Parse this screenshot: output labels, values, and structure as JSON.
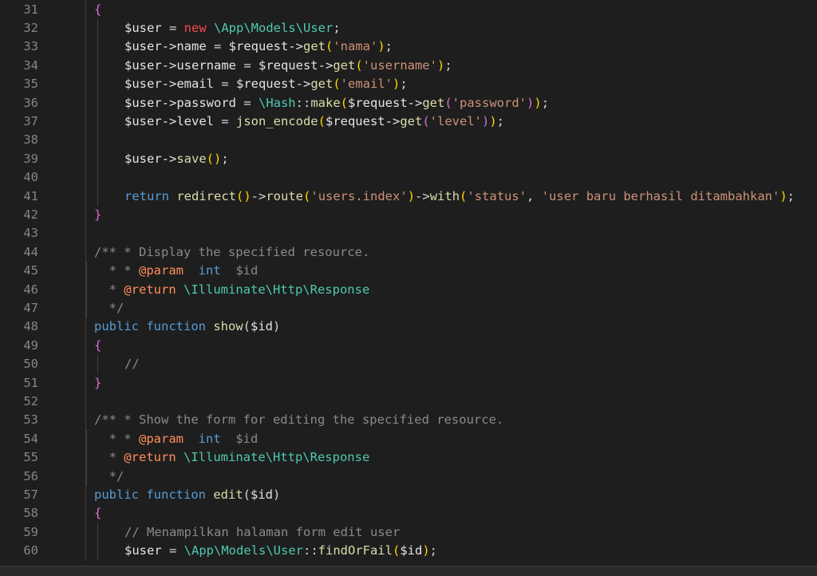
{
  "editor": {
    "colors": {
      "background": "#1e1e1e",
      "line_number": "#858585",
      "keyword": "#569cd6",
      "string": "#ce9178",
      "class": "#4ec9b0",
      "function": "#dcdcaa",
      "comment": "#8a8a8a",
      "new_keyword": "#f44747"
    },
    "lines": [
      {
        "n": "31",
        "indent": 1,
        "tokens": [
          [
            "{",
            "b"
          ]
        ]
      },
      {
        "n": "32",
        "indent": 2,
        "tokens": [
          [
            "$user",
            "v"
          ],
          [
            " = ",
            "t"
          ],
          [
            "new",
            "n"
          ],
          [
            " ",
            "t"
          ],
          [
            "\\App\\Models\\User",
            "c"
          ],
          [
            ";",
            "t"
          ]
        ]
      },
      {
        "n": "33",
        "indent": 2,
        "tokens": [
          [
            "$user->name",
            "v"
          ],
          [
            " = ",
            "t"
          ],
          [
            "$request->",
            "v"
          ],
          [
            "get",
            "f"
          ],
          [
            "(",
            "y"
          ],
          [
            "'nama'",
            "s"
          ],
          [
            ")",
            "y"
          ],
          [
            ";",
            "t"
          ]
        ]
      },
      {
        "n": "34",
        "indent": 2,
        "tokens": [
          [
            "$user->username",
            "v"
          ],
          [
            " = ",
            "t"
          ],
          [
            "$request->",
            "v"
          ],
          [
            "get",
            "f"
          ],
          [
            "(",
            "y"
          ],
          [
            "'username'",
            "s"
          ],
          [
            ")",
            "y"
          ],
          [
            ";",
            "t"
          ]
        ]
      },
      {
        "n": "35",
        "indent": 2,
        "tokens": [
          [
            "$user->email",
            "v"
          ],
          [
            " = ",
            "t"
          ],
          [
            "$request->",
            "v"
          ],
          [
            "get",
            "f"
          ],
          [
            "(",
            "y"
          ],
          [
            "'email'",
            "s"
          ],
          [
            ")",
            "y"
          ],
          [
            ";",
            "t"
          ]
        ]
      },
      {
        "n": "36",
        "indent": 2,
        "tokens": [
          [
            "$user->password",
            "v"
          ],
          [
            " = ",
            "t"
          ],
          [
            "\\Hash",
            "c"
          ],
          [
            "::",
            "t"
          ],
          [
            "make",
            "f"
          ],
          [
            "(",
            "y"
          ],
          [
            "$request->",
            "v"
          ],
          [
            "get",
            "f"
          ],
          [
            "(",
            "b"
          ],
          [
            "'password'",
            "s"
          ],
          [
            ")",
            "b"
          ],
          [
            ")",
            "y"
          ],
          [
            ";",
            "t"
          ]
        ]
      },
      {
        "n": "37",
        "indent": 2,
        "tokens": [
          [
            "$user->level",
            "v"
          ],
          [
            " = ",
            "t"
          ],
          [
            "json_encode",
            "f"
          ],
          [
            "(",
            "y"
          ],
          [
            "$request->",
            "v"
          ],
          [
            "get",
            "f"
          ],
          [
            "(",
            "b"
          ],
          [
            "'level'",
            "s"
          ],
          [
            ")",
            "b"
          ],
          [
            ")",
            "y"
          ],
          [
            ";",
            "t"
          ]
        ]
      },
      {
        "n": "38",
        "indent": 2,
        "tokens": []
      },
      {
        "n": "39",
        "indent": 2,
        "tokens": [
          [
            "$user->",
            "v"
          ],
          [
            "save",
            "f"
          ],
          [
            "()",
            "y"
          ],
          [
            ";",
            "t"
          ]
        ]
      },
      {
        "n": "40",
        "indent": 2,
        "tokens": []
      },
      {
        "n": "41",
        "indent": 2,
        "tokens": [
          [
            "return",
            "k"
          ],
          [
            " ",
            "t"
          ],
          [
            "redirect",
            "f"
          ],
          [
            "()",
            "y"
          ],
          [
            "->",
            "t"
          ],
          [
            "route",
            "f"
          ],
          [
            "(",
            "y"
          ],
          [
            "'users.index'",
            "s"
          ],
          [
            ")",
            "y"
          ],
          [
            "->",
            "t"
          ],
          [
            "with",
            "f"
          ],
          [
            "(",
            "y"
          ],
          [
            "'status'",
            "s"
          ],
          [
            ", ",
            "t"
          ],
          [
            "'user baru berhasil ditambahkan'",
            "s"
          ],
          [
            ")",
            "y"
          ],
          [
            ";",
            "t"
          ]
        ]
      },
      {
        "n": "42",
        "indent": 1,
        "tokens": [
          [
            "}",
            "b"
          ]
        ]
      },
      {
        "n": "43",
        "indent": 1,
        "tokens": []
      },
      {
        "n": "44",
        "indent": 1,
        "tokens": [
          [
            "/** * Display the specified resource.",
            "g"
          ]
        ]
      },
      {
        "n": "45",
        "indent": 1,
        "tokens": [
          [
            "  * * ",
            "g"
          ],
          [
            "@param",
            "d"
          ],
          [
            "  ",
            "t"
          ],
          [
            "int",
            "k"
          ],
          [
            "  $id",
            "g"
          ]
        ]
      },
      {
        "n": "46",
        "indent": 1,
        "tokens": [
          [
            "  * ",
            "g"
          ],
          [
            "@return",
            "d"
          ],
          [
            " ",
            "t"
          ],
          [
            "\\Illuminate\\Http\\Response",
            "c"
          ]
        ]
      },
      {
        "n": "47",
        "indent": 1,
        "tokens": [
          [
            "  */",
            "g"
          ]
        ]
      },
      {
        "n": "48",
        "indent": 1,
        "tokens": [
          [
            "public",
            "k"
          ],
          [
            " ",
            "t"
          ],
          [
            "function",
            "k"
          ],
          [
            " ",
            "t"
          ],
          [
            "show",
            "f"
          ],
          [
            "(",
            "t"
          ],
          [
            "$id",
            "v"
          ],
          [
            ")",
            "t"
          ]
        ]
      },
      {
        "n": "49",
        "indent": 1,
        "tokens": [
          [
            "{",
            "b"
          ]
        ]
      },
      {
        "n": "50",
        "indent": 2,
        "tokens": [
          [
            "//",
            "g"
          ]
        ]
      },
      {
        "n": "51",
        "indent": 1,
        "tokens": [
          [
            "}",
            "b"
          ]
        ]
      },
      {
        "n": "52",
        "indent": 1,
        "tokens": []
      },
      {
        "n": "53",
        "indent": 1,
        "tokens": [
          [
            "/** * Show the form for editing the specified resource.",
            "g"
          ]
        ]
      },
      {
        "n": "54",
        "indent": 1,
        "tokens": [
          [
            "  * * ",
            "g"
          ],
          [
            "@param",
            "d"
          ],
          [
            "  ",
            "t"
          ],
          [
            "int",
            "k"
          ],
          [
            "  $id",
            "g"
          ]
        ]
      },
      {
        "n": "55",
        "indent": 1,
        "tokens": [
          [
            "  * ",
            "g"
          ],
          [
            "@return",
            "d"
          ],
          [
            " ",
            "t"
          ],
          [
            "\\Illuminate\\Http\\Response",
            "c"
          ]
        ]
      },
      {
        "n": "56",
        "indent": 1,
        "tokens": [
          [
            "  */",
            "g"
          ]
        ]
      },
      {
        "n": "57",
        "indent": 1,
        "tokens": [
          [
            "public",
            "k"
          ],
          [
            " ",
            "t"
          ],
          [
            "function",
            "k"
          ],
          [
            " ",
            "t"
          ],
          [
            "edit",
            "f"
          ],
          [
            "(",
            "t"
          ],
          [
            "$id",
            "v"
          ],
          [
            ")",
            "t"
          ]
        ]
      },
      {
        "n": "58",
        "indent": 1,
        "tokens": [
          [
            "{",
            "b"
          ]
        ]
      },
      {
        "n": "59",
        "indent": 2,
        "tokens": [
          [
            "// Menampilkan halaman form edit user",
            "g"
          ]
        ]
      },
      {
        "n": "60",
        "indent": 2,
        "tokens": [
          [
            "$user",
            "v"
          ],
          [
            " = ",
            "t"
          ],
          [
            "\\App\\Models\\User",
            "c"
          ],
          [
            "::",
            "t"
          ],
          [
            "findOrFail",
            "f"
          ],
          [
            "(",
            "y"
          ],
          [
            "$id",
            "v"
          ],
          [
            ")",
            "y"
          ],
          [
            ";",
            "t"
          ]
        ]
      }
    ]
  }
}
